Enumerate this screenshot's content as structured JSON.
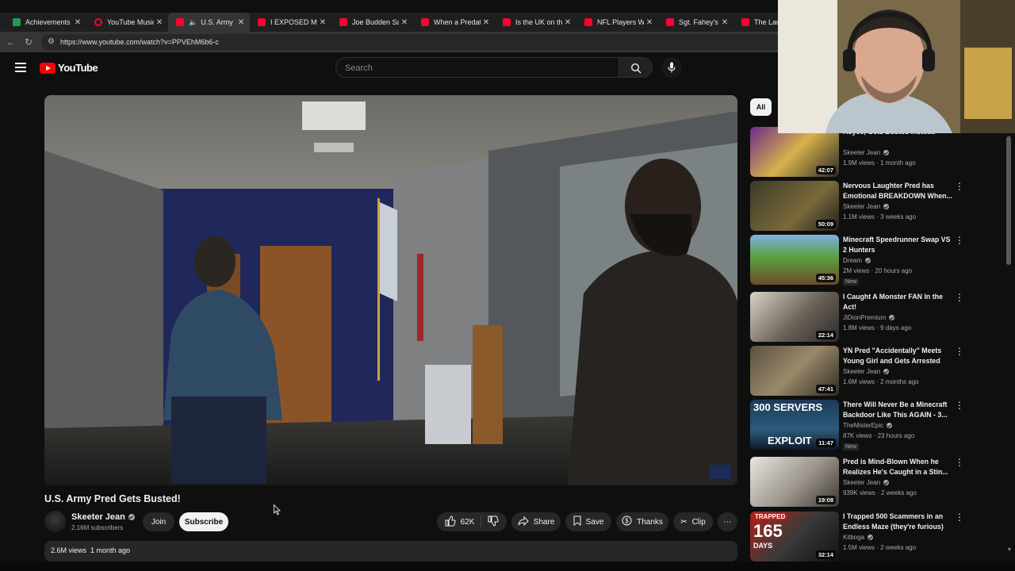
{
  "browser": {
    "tabs": [
      {
        "label": "Achievements - K",
        "favicon": "k-icon"
      },
      {
        "label": "YouTube Music",
        "favicon": "youtube-music-icon"
      },
      {
        "label": "U.S. Army Pr",
        "favicon": "youtube-icon",
        "active": true,
        "audio": true
      },
      {
        "label": "I EXPOSED My Bo",
        "favicon": "youtube-icon"
      },
      {
        "label": "Joe Budden Salut",
        "favicon": "youtube-icon"
      },
      {
        "label": "When a Predator",
        "favicon": "youtube-icon"
      },
      {
        "label": "Is the UK on the",
        "favicon": "youtube-icon"
      },
      {
        "label": "NFL Players Who",
        "favicon": "youtube-icon"
      },
      {
        "label": "Sgt. Fahey's \"Bro",
        "favicon": "youtube-icon"
      },
      {
        "label": "The Land",
        "favicon": "youtube-icon"
      }
    ],
    "url": "https://www.youtube.com/watch?v=PPVEhM6b6-c"
  },
  "header": {
    "logo_text": "YouTube",
    "search_placeholder": "Search"
  },
  "video": {
    "title": "U.S. Army Pred Gets Busted!",
    "channel": "Skeeter Jean",
    "subscribers": "2.16M subscribers",
    "join_label": "Join",
    "subscribe_label": "Subscribe",
    "likes": "62K",
    "share_label": "Share",
    "save_label": "Save",
    "thanks_label": "Thanks",
    "clip_label": "Clip",
    "views": "2.6M views",
    "age": "1 month ago"
  },
  "rail": {
    "chip_all": "All",
    "items": [
      {
        "title": "Royce, Gets Busted Instead",
        "channel": "Skeeter Jean",
        "verified": true,
        "meta": "1.9M views · 1 month ago",
        "duration": "42:07",
        "is_new": false
      },
      {
        "title": "Nervous Laughter Pred has Emotional BREAKDOWN When...",
        "channel": "Skeeter Jean",
        "verified": true,
        "meta": "1.1M views · 3 weeks ago",
        "duration": "50:09",
        "is_new": false
      },
      {
        "title": "Minecraft Speedrunner Swap VS 2 Hunters",
        "channel": "Dream",
        "verified": true,
        "meta": "2M views · 20 hours ago",
        "duration": "45:36",
        "is_new": true
      },
      {
        "title": "I Caught A Monster FAN In the Act!",
        "channel": "JiDionPremium",
        "verified": true,
        "meta": "1.8M views · 9 days ago",
        "duration": "22:14",
        "is_new": false
      },
      {
        "title": "YN Pred \"Accidentally\" Meets Young Girl and Gets Arrested",
        "channel": "Skeeter Jean",
        "verified": true,
        "meta": "1.6M views · 2 months ago",
        "duration": "47:41",
        "is_new": false
      },
      {
        "title": "There Will Never Be a Minecraft Backdoor Like This AGAIN - 3...",
        "channel": "TheMisterEpic",
        "verified": true,
        "meta": "87K views · 23 hours ago",
        "duration": "11:47",
        "is_new": true,
        "thumb_text_top": "300 SERVERS",
        "thumb_text_bottom": "EXPLOIT"
      },
      {
        "title": "Pred is Mind-Blown When he Realizes He's Caught in a Stin...",
        "channel": "Skeeter Jean",
        "verified": true,
        "meta": "939K views · 2 weeks ago",
        "duration": "19:08",
        "is_new": false
      },
      {
        "title": "I Trapped 500 Scammers in an Endless Maze (they're furious)",
        "channel": "Kitboga",
        "verified": true,
        "meta": "1.5M views · 2 weeks ago",
        "duration": "32:14",
        "is_new": false,
        "thumb_text_top": "TRAPPED",
        "thumb_text_big": "165",
        "thumb_text_bottom": "DAYS"
      }
    ],
    "new_label": "New"
  },
  "colors": {
    "background": "#0f0f0f",
    "youtube_red": "#ff0000",
    "text_primary": "#f1f1f1",
    "text_secondary": "#aaaaaa",
    "pill_bg": "#272727"
  }
}
